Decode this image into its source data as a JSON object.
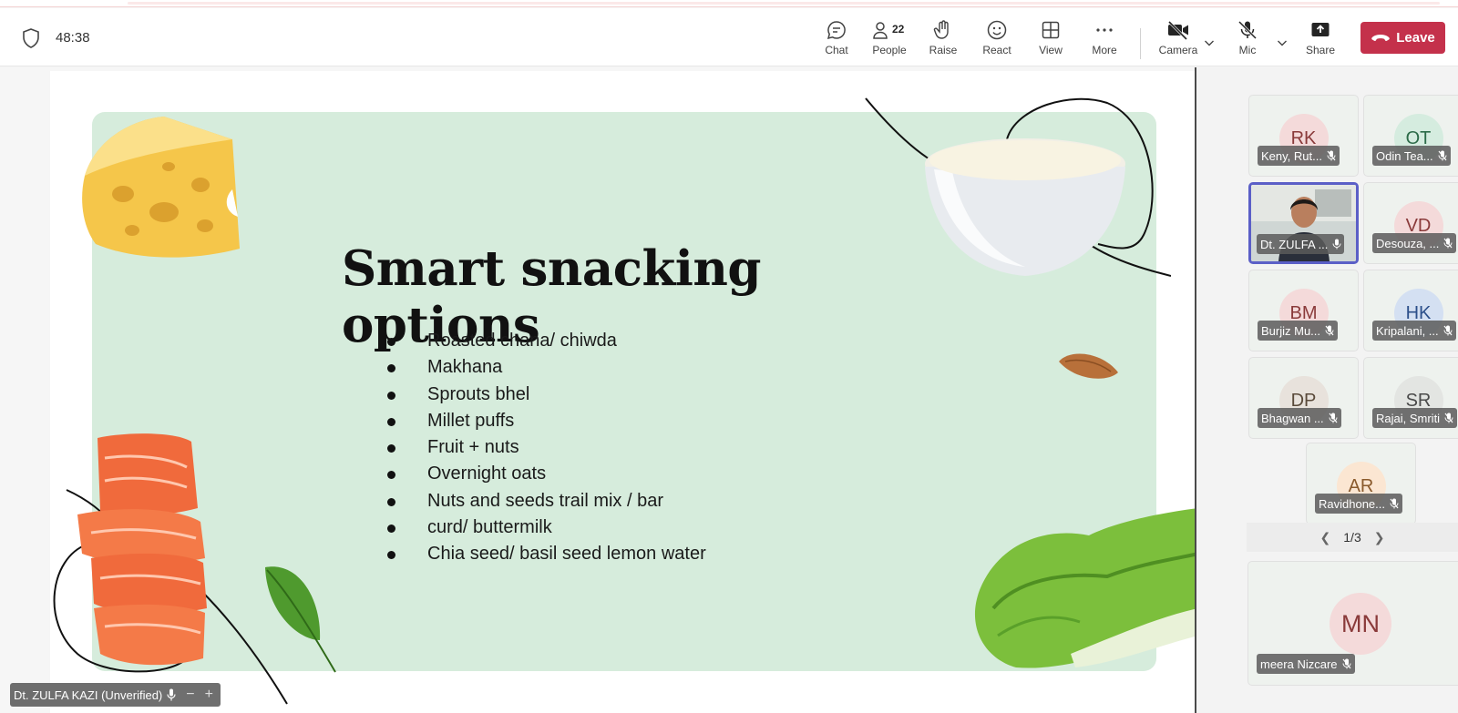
{
  "header": {
    "timer": "48:38",
    "buttons": [
      {
        "id": "chat",
        "label": "Chat",
        "icon": "chat-icon"
      },
      {
        "id": "people",
        "label": "People",
        "icon": "people-icon",
        "count": "22"
      },
      {
        "id": "raise",
        "label": "Raise",
        "icon": "hand-icon"
      },
      {
        "id": "react",
        "label": "React",
        "icon": "smiley-icon"
      },
      {
        "id": "view",
        "label": "View",
        "icon": "grid-icon"
      },
      {
        "id": "more",
        "label": "More",
        "icon": "ellipsis-icon"
      },
      {
        "id": "camera",
        "label": "Camera",
        "icon": "camera-off-icon"
      },
      {
        "id": "mic",
        "label": "Mic",
        "icon": "mic-off-icon"
      },
      {
        "id": "share",
        "label": "Share",
        "icon": "share-icon"
      }
    ],
    "leave_label": "Leave",
    "leave_color": "#c4314b"
  },
  "slide": {
    "title": "Smart snacking options",
    "bullets": [
      "Roasted chana/ chiwda",
      "Makhana",
      "Sprouts bhel",
      "Millet puffs",
      "Fruit + nuts",
      "Overnight oats",
      "Nuts and seeds trail mix / bar",
      "curd/ buttermilk",
      "Chia seed/ basil seed lemon water"
    ],
    "panel_color": "#d6ecdc"
  },
  "presenter": {
    "name": "Dt. ZULFA KAZI (Unverified)"
  },
  "gallery": {
    "participants": [
      {
        "initials": "RK",
        "name": "Keny, Rut...",
        "bg": "#f4dada",
        "fg": "#8a3a3a"
      },
      {
        "initials": "OT",
        "name": "Odin Tea...",
        "bg": "#d5ecdf",
        "fg": "#2c6b48"
      },
      {
        "initials": "",
        "name": "Dt. ZULFA ...",
        "video": true,
        "active": true
      },
      {
        "initials": "VD",
        "name": "Desouza, ...",
        "bg": "#f4dada",
        "fg": "#8a3a3a"
      },
      {
        "initials": "BM",
        "name": "Burjiz Mu...",
        "bg": "#f4dada",
        "fg": "#8a3a3a"
      },
      {
        "initials": "HK",
        "name": "Kripalani, ...",
        "bg": "#d4e0f2",
        "fg": "#2c4f8a"
      },
      {
        "initials": "DP",
        "name": "Bhagwan ...",
        "bg": "#e8e2dc",
        "fg": "#5a4a3a"
      },
      {
        "initials": "SR",
        "name": "Rajai, Smriti",
        "bg": "#e3e5e2",
        "fg": "#4a4a4a"
      },
      {
        "initials": "AR",
        "name": "Ravidhone...",
        "bg": "#fbe6d2",
        "fg": "#8a5a2c"
      }
    ],
    "pager": "1/3",
    "self": {
      "initials": "MN",
      "name": "meera Nizcare",
      "bg": "#f4dada",
      "fg": "#8a3a3a"
    }
  }
}
